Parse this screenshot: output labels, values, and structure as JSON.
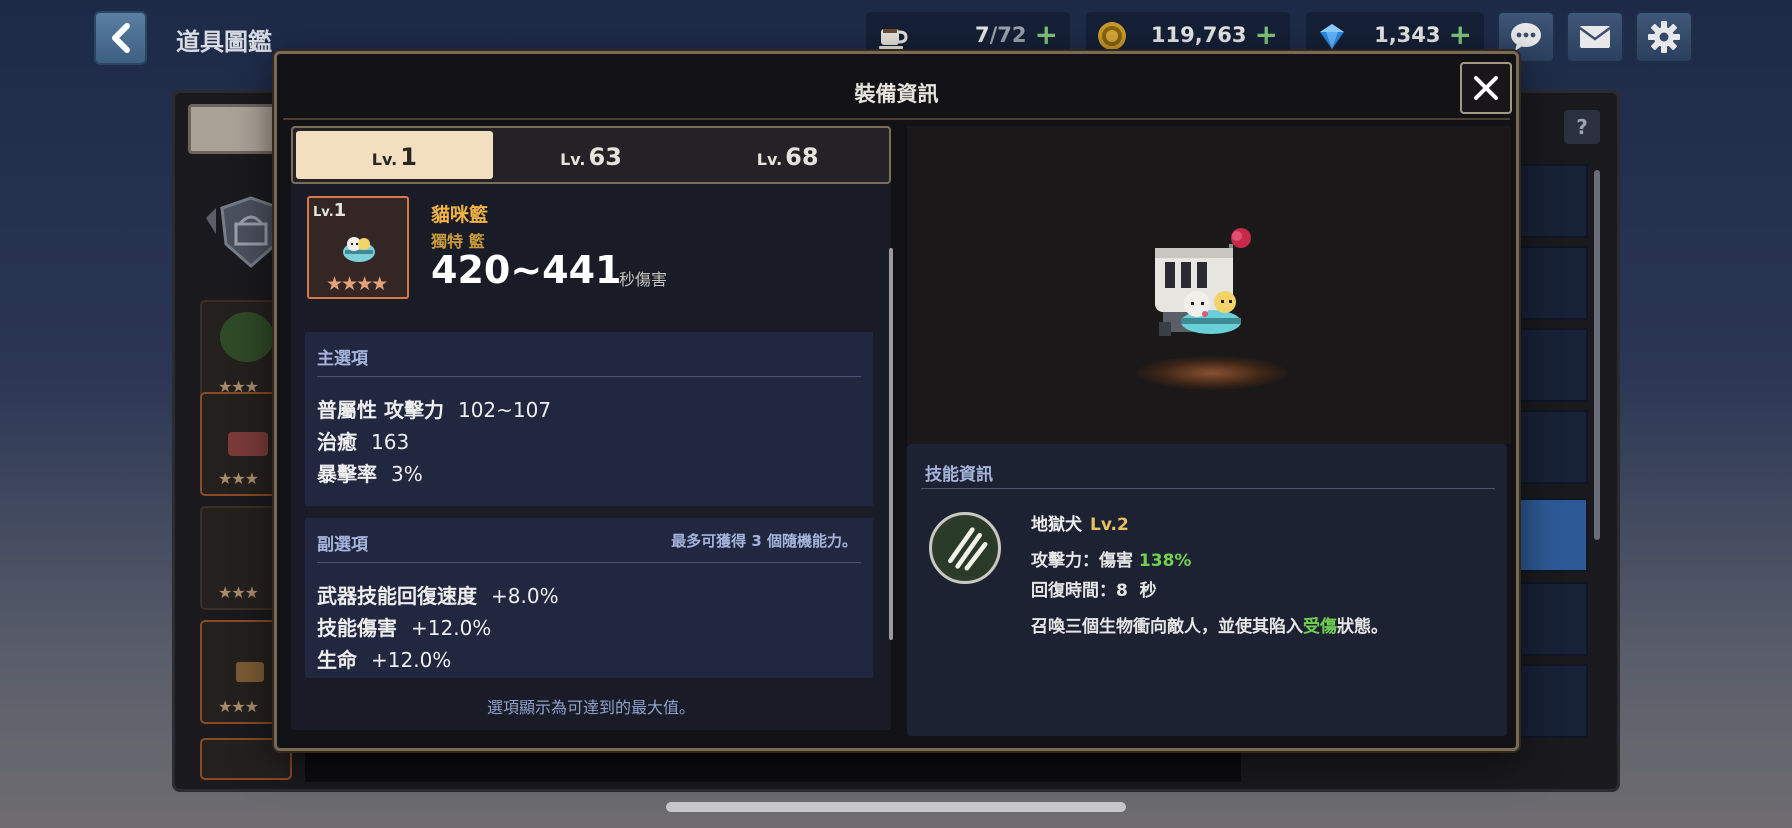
{
  "header": {
    "back_icon": "chevron-left-icon",
    "title": "道具圖鑑",
    "resources": [
      {
        "icon": "coffee-icon",
        "value": "7",
        "max": "/72"
      },
      {
        "icon": "gold-coin-icon",
        "value": "119,763"
      },
      {
        "icon": "gem-icon",
        "value": "1,343"
      }
    ],
    "buttons": [
      "chat-icon",
      "mail-icon",
      "gear-icon"
    ]
  },
  "background": {
    "help_label": "?"
  },
  "modal": {
    "title": "裝備資訊",
    "close_icon": "close-icon",
    "level_tabs": [
      {
        "prefix": "Lv.",
        "level": "1",
        "active": true
      },
      {
        "prefix": "Lv.",
        "level": "63",
        "active": false
      },
      {
        "prefix": "Lv.",
        "level": "68",
        "active": false
      }
    ],
    "item": {
      "level_prefix": "Lv.",
      "level": "1",
      "stars": "★★★★",
      "name": "貓咪籃",
      "subtitle": "獨特 籃",
      "damage": "420~441",
      "damage_unit": "秒傷害"
    },
    "main_options": {
      "title": "主選項",
      "rows": [
        {
          "label": "普屬性 攻擊力",
          "value": "102~107"
        },
        {
          "label": "治癒",
          "value": "163"
        },
        {
          "label": "暴擊率",
          "value": "3%"
        }
      ]
    },
    "sub_options": {
      "title": "副選項",
      "note": "最多可獲得  3  個隨機能力。",
      "rows": [
        {
          "label": "武器技能回復速度",
          "value": "+8.0%"
        },
        {
          "label": "技能傷害",
          "value": "+12.0%"
        },
        {
          "label": "生命",
          "value": "+12.0%"
        }
      ]
    },
    "footer_note": "選項顯示為可達到的最大值。",
    "skill": {
      "title": "技能資訊",
      "icon": "claw-slash-icon",
      "name": "地獄犬",
      "level": "Lv.2",
      "attack_label": "攻擊力：傷害",
      "attack_value": "138%",
      "cooldown": "回復時間：8  秒",
      "desc_before": "召喚三個生物衝向敵人，並使其陷入",
      "desc_highlight": "受傷",
      "desc_after": "狀態。"
    }
  }
}
